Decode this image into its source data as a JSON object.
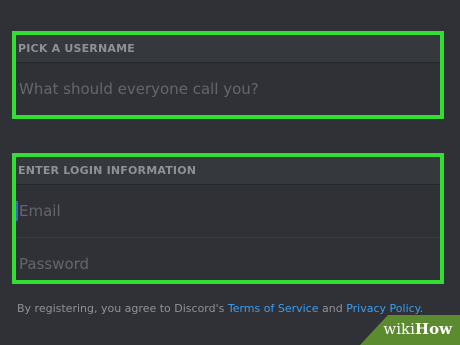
{
  "username_section": {
    "header": "PICK A USERNAME",
    "placeholder": "What should everyone call you?"
  },
  "login_section": {
    "header": "ENTER LOGIN INFORMATION",
    "email_placeholder": "Email",
    "password_placeholder": "Password"
  },
  "footer": {
    "prefix": "By registering, you agree to Discord's ",
    "terms_link": "Terms of Service",
    "conjunction": " and ",
    "privacy_link": "Privacy Policy",
    "suffix": "."
  },
  "watermark": {
    "brand_part1": "wiki",
    "brand_part2": "How"
  },
  "colors": {
    "background": "#2f3136",
    "highlight_border": "#33dd33",
    "link": "#3d9ef0",
    "cursor": "#3a64c8"
  }
}
